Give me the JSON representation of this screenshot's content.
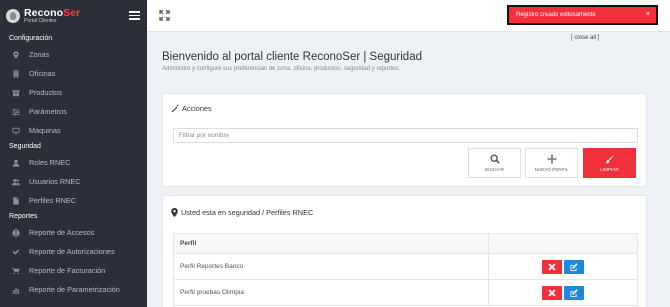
{
  "brand": {
    "name_part1": "Recono",
    "name_part2": "Ser",
    "subtitle": "Portal Clientes"
  },
  "sidebar": {
    "sections": [
      {
        "title": "Configuración",
        "items": [
          {
            "label": "Zonas",
            "icon": "map-marker-icon"
          },
          {
            "label": "Oficinas",
            "icon": "building-icon"
          },
          {
            "label": "Productos",
            "icon": "box-icon"
          },
          {
            "label": "Parámetros",
            "icon": "sliders-icon"
          },
          {
            "label": "Máquinas",
            "icon": "desktop-icon"
          }
        ]
      },
      {
        "title": "Seguridad",
        "items": [
          {
            "label": "Roles RNEC",
            "icon": "user-icon"
          },
          {
            "label": "Usuarios RNEC",
            "icon": "users-icon"
          },
          {
            "label": "Perfiles RNEC",
            "icon": "file-icon"
          }
        ]
      },
      {
        "title": "Reportes",
        "items": [
          {
            "label": "Reporte de Accesos",
            "icon": "globe-icon"
          },
          {
            "label": "Reporte de Autorizaciones",
            "icon": "check-icon"
          },
          {
            "label": "Reporte de Facturación",
            "icon": "cart-icon"
          },
          {
            "label": "Reporte de Parametrización",
            "icon": "chart-icon"
          }
        ]
      }
    ]
  },
  "toast": {
    "message": "Registro creado exitosamente",
    "close": "×",
    "close_all": "[ close all ]",
    "color": "#f0303a"
  },
  "page": {
    "title": "Bienvenido al portal cliente ReconoSer | Seguridad",
    "subtitle": "Administre y configure sus preferencias de zona, oficina, productos, seguridad y reportes."
  },
  "actions_panel": {
    "title": "Acciones",
    "filter_placeholder": "Filtrar por nombre",
    "filter_value": "",
    "buttons": {
      "search": "BUSCAR",
      "new": "NUEVO PERFIL",
      "clear": "LIMPIAR"
    }
  },
  "perfiles_panel": {
    "breadcrumb": "Usted esta en seguridad / Perfiles RNEC",
    "table": {
      "headers": [
        "Perfil",
        ""
      ],
      "rows": [
        {
          "name": "Perfil Reportes Banco"
        },
        {
          "name": "Perfil pruebas Olimpia"
        }
      ]
    }
  },
  "colors": {
    "sidebar_bg": "#2b2f3a",
    "accent_red": "#f0303a",
    "edit_blue": "#1e88d9"
  }
}
